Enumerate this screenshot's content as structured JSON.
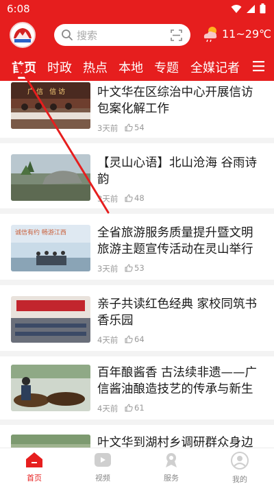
{
  "status": {
    "time": "6:08"
  },
  "header": {
    "search_placeholder": "搜索",
    "weather": "11~29℃",
    "tabs": [
      {
        "label": "首页"
      },
      {
        "label": "时政"
      },
      {
        "label": "热点"
      },
      {
        "label": "本地"
      },
      {
        "label": "专题"
      },
      {
        "label": "全媒记者"
      }
    ]
  },
  "feed": [
    {
      "title": "叶文华在区综治中心开展信访包案化解工作",
      "time": "3天前",
      "likes": "54",
      "thumb_text": "广信 信访"
    },
    {
      "title": "【灵山心语】北山沧海 谷雨诗韵",
      "time": "3天前",
      "likes": "48"
    },
    {
      "title": "全省旅游服务质量提升暨文明旅游主题宣传活动在灵山举行",
      "time": "3天前",
      "likes": "53",
      "thumb_text": "诚信有约  畅游江西"
    },
    {
      "title": "亲子共读红色经典 家校同筑书香乐园",
      "time": "4天前",
      "likes": "64"
    },
    {
      "title": "百年酿酱香 古法续非遗——广信酱油酿造技艺的传承与新生",
      "time": "4天前",
      "likes": "61"
    },
    {
      "title": "叶文华到湖村乡调研群众身边"
    }
  ],
  "bottom_nav": [
    {
      "label": "首页",
      "icon": "home-icon"
    },
    {
      "label": "视频",
      "icon": "video-icon"
    },
    {
      "label": "服务",
      "icon": "service-icon"
    },
    {
      "label": "我的",
      "icon": "profile-icon"
    }
  ],
  "colors": {
    "brand": "#e61e1e",
    "inactive": "#888888"
  }
}
